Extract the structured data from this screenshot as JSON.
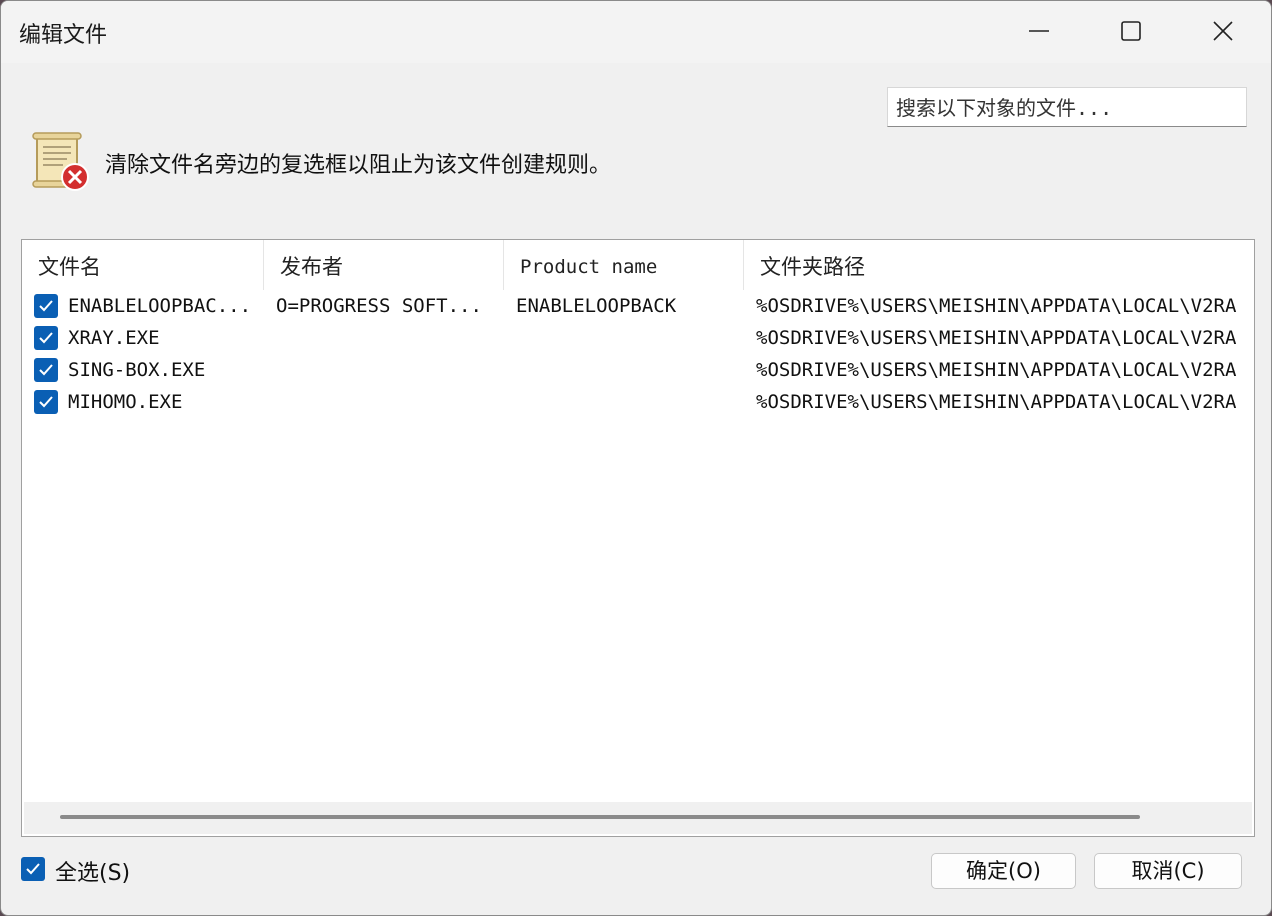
{
  "window": {
    "title": "编辑文件"
  },
  "search": {
    "placeholder": "搜索以下对象的文件..."
  },
  "message": "清除文件名旁边的复选框以阻止为该文件创建规则。",
  "table": {
    "columns": [
      "文件名",
      "发布者",
      "Product name",
      "文件夹路径"
    ],
    "rows": [
      {
        "checked": true,
        "file": "ENABLELOOPBAC...",
        "publisher": "O=PROGRESS SOFT...",
        "product": "ENABLELOOPBACK",
        "path": "%OSDRIVE%\\USERS\\MEISHIN\\APPDATA\\LOCAL\\V2RA"
      },
      {
        "checked": true,
        "file": "XRAY.EXE",
        "publisher": "",
        "product": "",
        "path": "%OSDRIVE%\\USERS\\MEISHIN\\APPDATA\\LOCAL\\V2RA"
      },
      {
        "checked": true,
        "file": "SING-BOX.EXE",
        "publisher": "",
        "product": "",
        "path": "%OSDRIVE%\\USERS\\MEISHIN\\APPDATA\\LOCAL\\V2RA"
      },
      {
        "checked": true,
        "file": "MIHOMO.EXE",
        "publisher": "",
        "product": "",
        "path": "%OSDRIVE%\\USERS\\MEISHIN\\APPDATA\\LOCAL\\V2RA"
      }
    ]
  },
  "footer": {
    "select_all_label": "全选(S)",
    "select_all_checked": true,
    "ok_label": "确定(O)",
    "cancel_label": "取消(C)"
  },
  "colors": {
    "accent": "#0a5fb4",
    "error": "#d32f2f"
  }
}
